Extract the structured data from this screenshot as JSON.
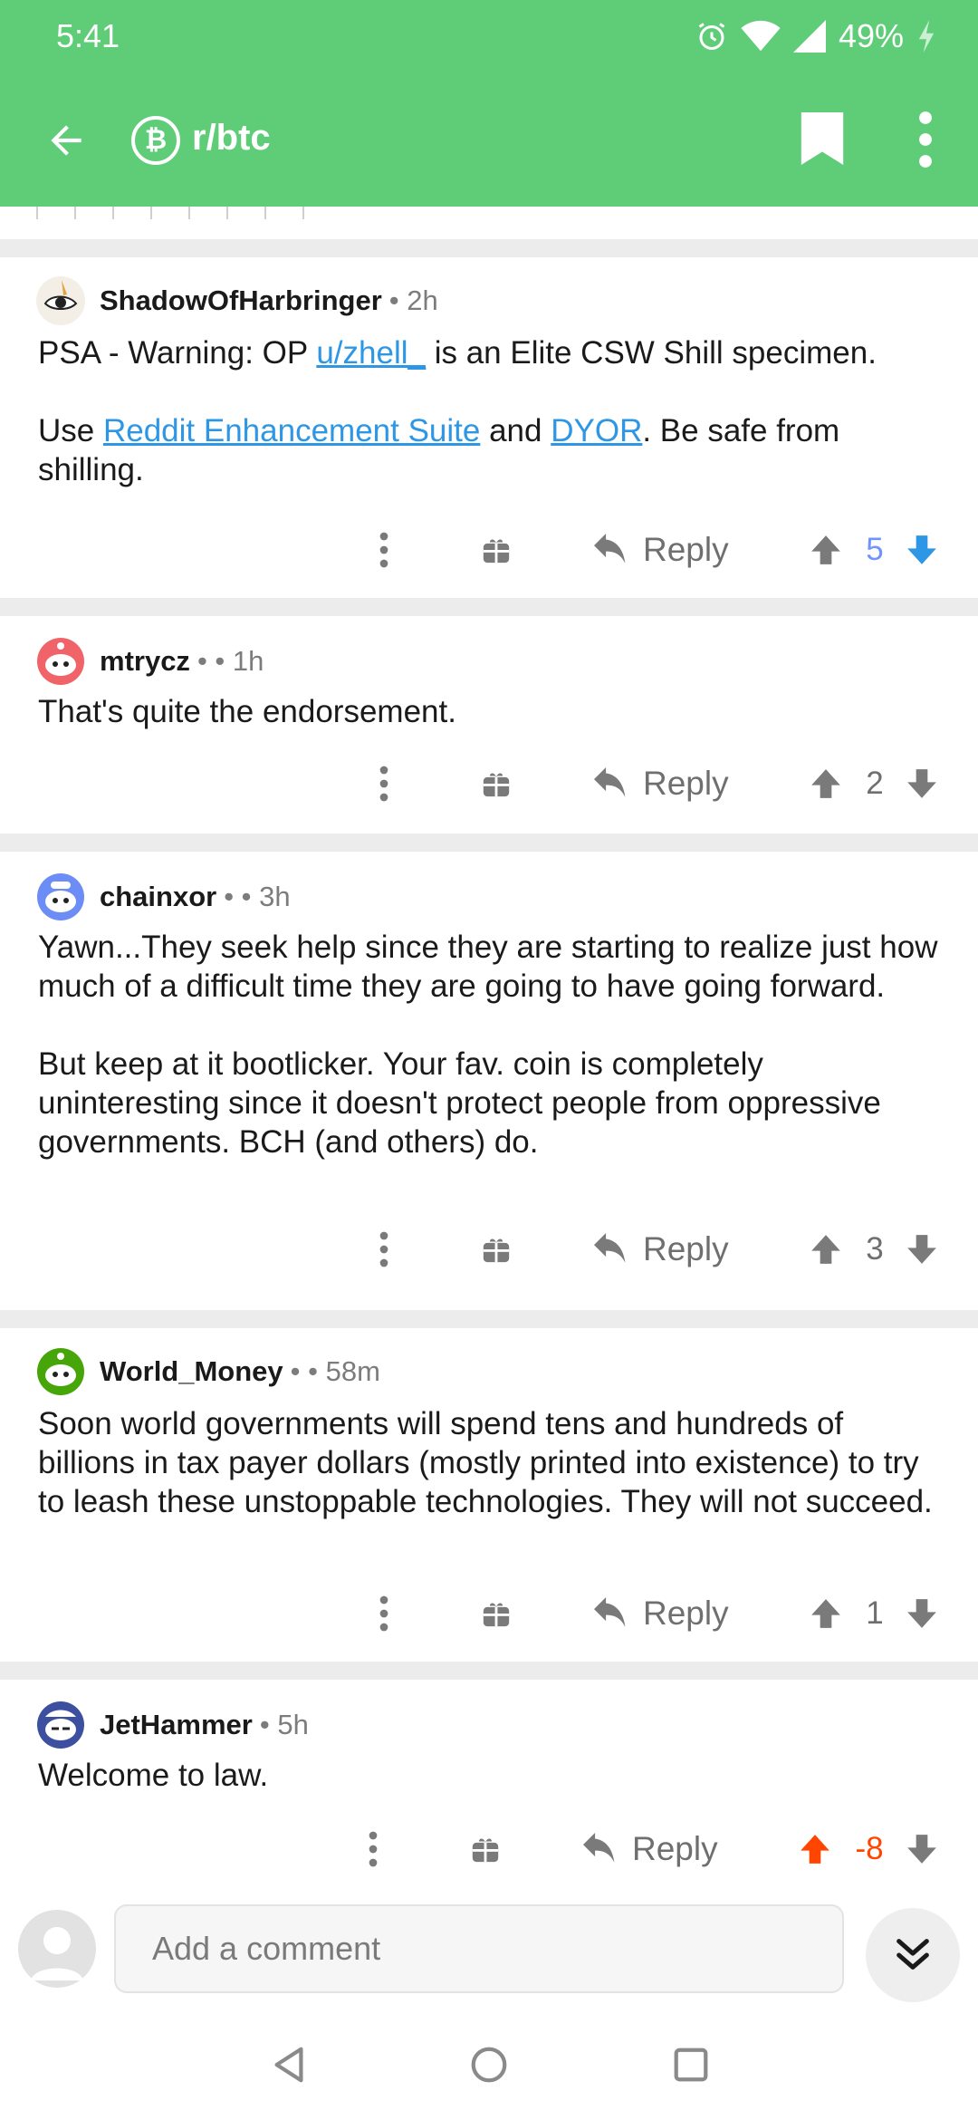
{
  "status": {
    "time": "5:41",
    "battery": "49%"
  },
  "toolbar": {
    "subreddit": "r/btc",
    "badge_glyph": "₿"
  },
  "comments": [
    {
      "user": "ShadowOfHarbringer",
      "meta": "• 2h",
      "p1_a": "PSA - Warning: OP ",
      "p1_link": "u/zhell_",
      "p1_b": " is an Elite CSW Shill specimen.",
      "p2_a": "Use ",
      "p2_link1": "Reddit Enhancement Suite",
      "p2_b": " and ",
      "p2_link2": "DYOR",
      "p2_c": ". Be safe from shilling.",
      "reply": "Reply",
      "score": "5",
      "vote": "downvoted-none",
      "score_color": "#7193ff"
    },
    {
      "user": "mtrycz",
      "meta": "•  • 1h",
      "text": "That's quite the endorsement.",
      "reply": "Reply",
      "score": "2"
    },
    {
      "user": "chainxor",
      "meta": "•  • 3h",
      "p1": "Yawn...They seek help since they are starting to realize just how much of a difficult time they are going to have going forward.",
      "p2": "But keep at it bootlicker. Your fav. coin is completely uninteresting since it doesn't protect people from oppressive governments. BCH (and others) do.",
      "reply": "Reply",
      "score": "3"
    },
    {
      "user": "World_Money",
      "meta": "•  • 58m",
      "text": "Soon world governments will spend tens and hundreds of billions in tax payer dollars (mostly printed into existence) to try to leash these unstoppable technologies. They will not succeed.",
      "reply": "Reply",
      "score": "1"
    },
    {
      "user": "JetHammer",
      "meta": "• 5h",
      "text": "Welcome to law.",
      "reply": "Reply",
      "score": "-8",
      "score_color": "#ff4500"
    }
  ],
  "composer": {
    "placeholder": "Add a comment"
  },
  "colors": {
    "appbar": "#5fcc78",
    "link": "#2d97e5",
    "upvote": "#ff4500",
    "downvote_active": "#2d97e5"
  },
  "icons": [
    "back-arrow-icon",
    "bitcoin-icon",
    "bookmark-icon",
    "more-vert-icon",
    "gift-icon",
    "reply-icon",
    "upvote-icon",
    "downvote-icon",
    "collapse-icon"
  ]
}
